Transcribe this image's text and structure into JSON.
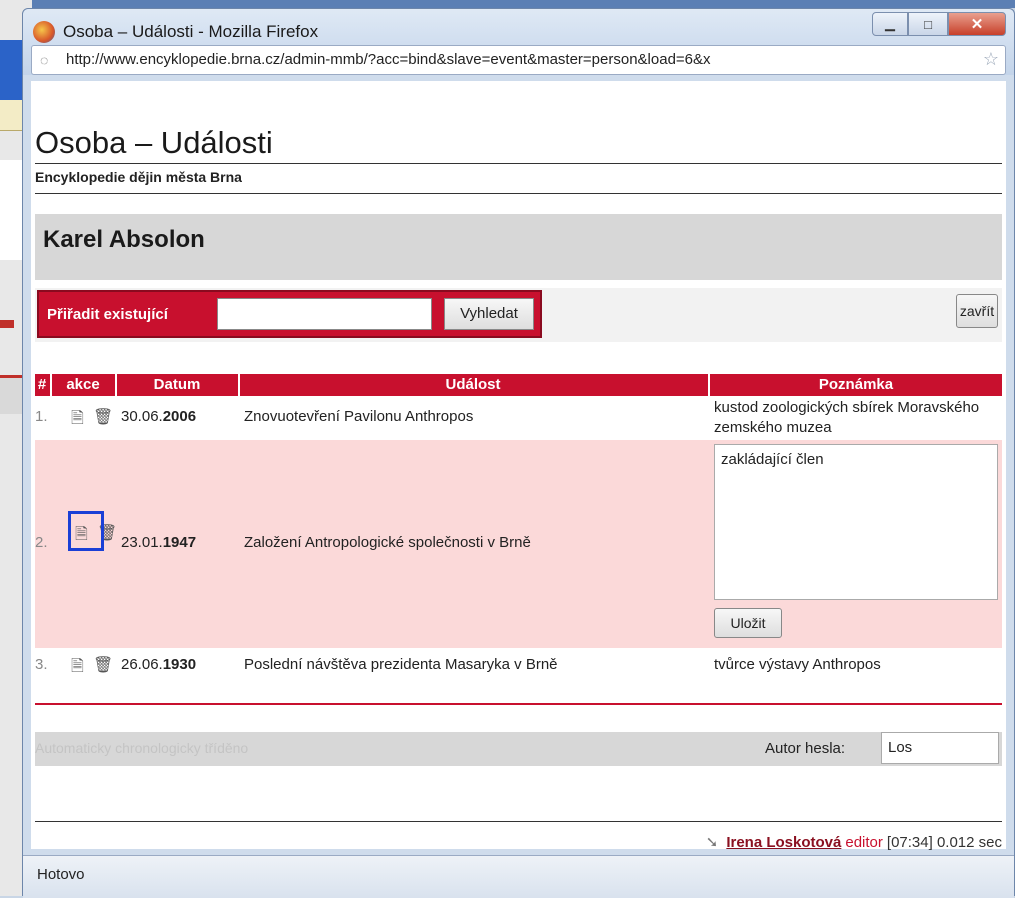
{
  "window": {
    "title": "Osoba – Události - Mozilla Firefox",
    "url": "http://www.encyklopedie.brna.cz/admin-mmb/?acc=bind&slave=event&master=person&load=6&x"
  },
  "page": {
    "heading": "Osoba – Události",
    "subtitle": "Encyklopedie dějin města Brna",
    "person_name": "Karel Absolon"
  },
  "assign": {
    "label": "Přiřadit existující",
    "input_value": "",
    "search_button": "Vyhledat",
    "close_button": "zavřít"
  },
  "table": {
    "headers": [
      "#",
      "akce",
      "Datum",
      "Událost",
      "Poznámka"
    ],
    "rows": [
      {
        "num": "1.",
        "date_prefix": "30.06.",
        "year": "2006",
        "event": "Znovuotevření Pavilonu Anthropos",
        "note": "kustod zoologických sbírek Moravského zemského muzea"
      },
      {
        "num": "2.",
        "date_prefix": "23.01.",
        "year": "1947",
        "event": "Založení Antropologické společnosti v Brně",
        "note": "zakládající člen"
      },
      {
        "num": "3.",
        "date_prefix": "26.06.",
        "year": "1930",
        "event": "Poslední návštěva prezidenta Masaryka v Brně",
        "note": "tvůrce výstavy Anthropos"
      }
    ],
    "save_button": "Uložit"
  },
  "footer": {
    "auto_sorted": "Automaticky chronologicky tříděno",
    "author_label": "Autor hesla:",
    "author_value": "Los",
    "user_name": "Irena Loskotová",
    "user_role": "editor",
    "timing": "[07:34] 0.012 sec"
  },
  "status": {
    "text": "Hotovo"
  },
  "icons": {
    "edit": "edit-icon",
    "delete": "trash-icon"
  },
  "colors": {
    "accent": "#c8102e",
    "edit_row": "#fbd9d9",
    "highlight": "#1a3fd6"
  }
}
